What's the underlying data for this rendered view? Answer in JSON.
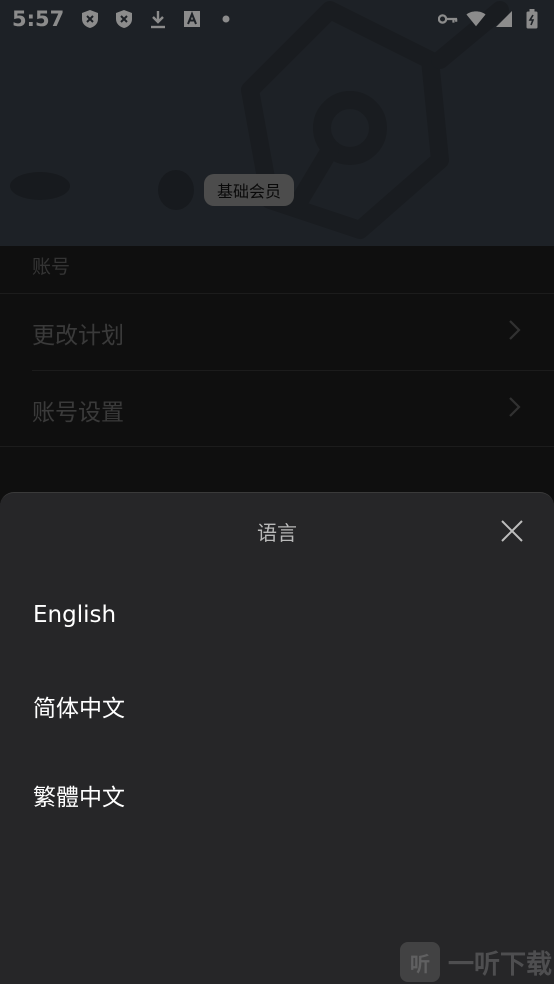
{
  "status_bar": {
    "time": "5:57",
    "icons_left": [
      "shield-x-icon",
      "shield-x-icon",
      "download-icon",
      "font-icon",
      "dot-icon"
    ],
    "icons_right": [
      "key-icon",
      "wifi-icon",
      "signal-icon",
      "battery-icon"
    ]
  },
  "header": {
    "badge": "基础会员",
    "bg_color": "#363d45"
  },
  "account": {
    "section_label": "账号",
    "items": [
      {
        "label": "更改计划"
      },
      {
        "label": "账号设置"
      }
    ]
  },
  "language_sheet": {
    "title": "语言",
    "options": [
      {
        "label": "English"
      },
      {
        "label": "简体中文"
      },
      {
        "label": "繁體中文"
      }
    ]
  },
  "watermark": {
    "logo_text": "听",
    "text": "一听下载"
  }
}
